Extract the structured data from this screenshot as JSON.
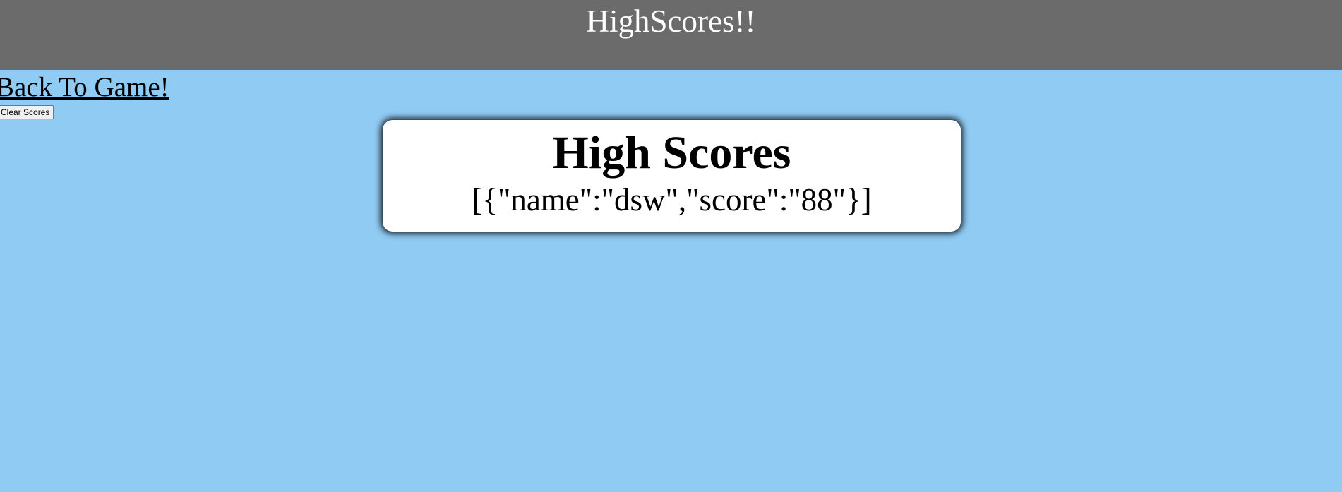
{
  "header": {
    "title": "HighScores!!"
  },
  "nav": {
    "back_link_label": "Back To Game!",
    "clear_button_label": "Clear Scores"
  },
  "scores_card": {
    "title": "High Scores",
    "scores_text": "[{\"name\":\"dsw\",\"score\":\"88\"}]",
    "entries": [
      {
        "name": "dsw",
        "score": "88"
      }
    ]
  },
  "colors": {
    "page_background": "#90cbf4",
    "header_background": "#6b6b6b",
    "card_background": "#ffffff"
  }
}
